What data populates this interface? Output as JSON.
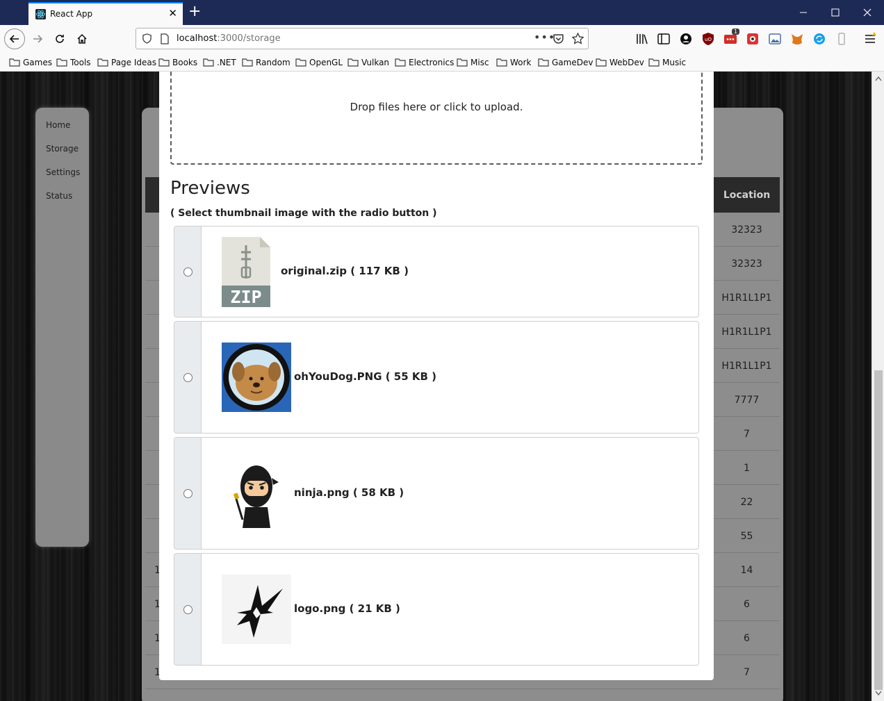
{
  "browser": {
    "tab_title": "React App",
    "url_host": "localhost",
    "url_path": ":3000/storage",
    "extension_badge": "1",
    "bookmarks": [
      "Games",
      "Tools",
      "Page Ideas",
      "Books",
      ".NET",
      "Random",
      "OpenGL",
      "Vulkan",
      "Electronics",
      "Misc",
      "Work",
      "GameDev",
      "WebDev",
      "Music"
    ]
  },
  "sidebar": {
    "items": [
      {
        "label": "Home"
      },
      {
        "label": "Storage"
      },
      {
        "label": "Settings"
      },
      {
        "label": "Status"
      }
    ]
  },
  "table": {
    "location_header": "Location",
    "rows": [
      {
        "left": "",
        "location": "32323"
      },
      {
        "left": "",
        "location": "32323"
      },
      {
        "left": "",
        "location": "H1R1L1P1"
      },
      {
        "left": "",
        "location": "H1R1L1P1"
      },
      {
        "left": "",
        "location": "H1R1L1P1"
      },
      {
        "left": "",
        "location": "7777"
      },
      {
        "left": "",
        "location": "7"
      },
      {
        "left": "",
        "location": "1"
      },
      {
        "left": "",
        "location": "22"
      },
      {
        "left": "",
        "location": "55"
      },
      {
        "left": "1",
        "location": "14"
      },
      {
        "left": "1",
        "location": "6"
      },
      {
        "left": "1",
        "location": "6"
      },
      {
        "left": "1",
        "location": "7"
      }
    ]
  },
  "modal": {
    "dropzone_text": "Drop files here or click to upload.",
    "previews_title": "Previews",
    "previews_hint": "( Select thumbnail image with the radio button )",
    "files": [
      {
        "label": "original.zip ( 117 KB )",
        "icon": "zip-file-icon",
        "selected": false
      },
      {
        "label": "ohYouDog.PNG ( 55 KB )",
        "icon": "dog-image-thumbnail",
        "selected": false
      },
      {
        "label": "ninja.png ( 58 KB )",
        "icon": "ninja-image-thumbnail",
        "selected": false
      },
      {
        "label": "logo.png ( 21 KB )",
        "icon": "star-logo-thumbnail",
        "selected": false
      }
    ],
    "zip_icon_text": "ZIP"
  },
  "colors": {
    "titlebar": "#1e2a56",
    "accent": "#0a84ff",
    "modal_bg": "#ffffff",
    "table_header": "#2b2b2b"
  }
}
